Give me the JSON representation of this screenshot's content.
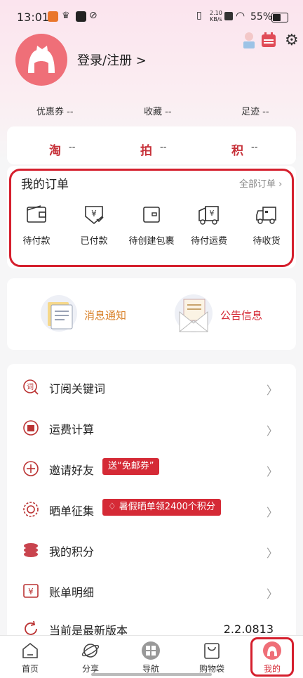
{
  "status_bar": {
    "time": "13:01",
    "net_speed_top": "2.10",
    "net_speed_bottom": "KB/s",
    "battery": "55%"
  },
  "header": {
    "login_label": "登录/注册 >"
  },
  "stats": [
    {
      "label": "优惠券 --"
    },
    {
      "label": "收藏 --"
    },
    {
      "label": "足迹 --"
    }
  ],
  "points_bar": [
    {
      "char": "淘",
      "value": "--"
    },
    {
      "char": "拍",
      "value": "--"
    },
    {
      "char": "积",
      "value": "--"
    }
  ],
  "orders": {
    "title": "我的订单",
    "all_label": "全部订单",
    "items": [
      {
        "label": "待付款",
        "icon": "wallet-icon"
      },
      {
        "label": "已付款",
        "icon": "paid-yen-icon"
      },
      {
        "label": "待创建包裹",
        "icon": "package-box-icon"
      },
      {
        "label": "待付运费",
        "icon": "truck-yen-icon"
      },
      {
        "label": "待收货",
        "icon": "delivery-truck-icon"
      }
    ]
  },
  "messages": {
    "notify_label": "消息通知",
    "announce_label": "公告信息",
    "notify_color": "#d9822b",
    "announce_color": "#d52a36"
  },
  "menu": [
    {
      "label": "订阅关键词",
      "icon": "keyword-icon"
    },
    {
      "label": "运费计算",
      "icon": "shipping-calc-icon"
    },
    {
      "label": "邀请好友",
      "icon": "invite-plus-icon",
      "tag": "送“免邮券”"
    },
    {
      "label": "晒单征集",
      "icon": "sun-show-icon",
      "tag": "暑假晒单领2400个积分"
    },
    {
      "label": "我的积分",
      "icon": "coins-icon"
    },
    {
      "label": "账单明细",
      "icon": "bill-icon"
    },
    {
      "label": "当前是最新版本",
      "icon": "refresh-icon",
      "value": "2.2.0813"
    }
  ],
  "nav": [
    {
      "label": "首页",
      "icon": "home-icon"
    },
    {
      "label": "分享",
      "icon": "planet-icon"
    },
    {
      "label": "导航",
      "icon": "grid-icon"
    },
    {
      "label": "购物袋",
      "icon": "bag-icon"
    },
    {
      "label": "我的",
      "icon": "profile-icon",
      "active": true
    }
  ],
  "colors": {
    "accent": "#d52a36",
    "avatar": "#ef6f78"
  }
}
